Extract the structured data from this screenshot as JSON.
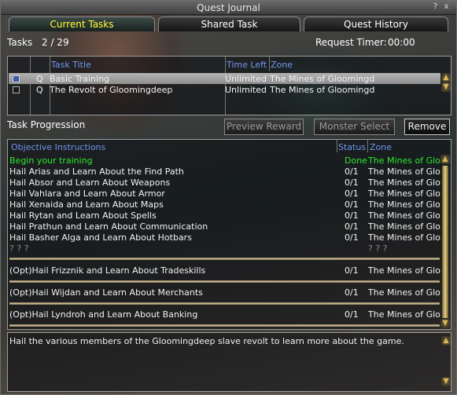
{
  "window": {
    "title": "Quest Journal",
    "help_glyph": "?",
    "close_glyph": "x"
  },
  "tabs": [
    {
      "label": "Current Tasks",
      "active": true
    },
    {
      "label": "Shared Task",
      "active": false
    },
    {
      "label": "Quest History",
      "active": false
    }
  ],
  "summary": {
    "tasks_label": "Tasks",
    "tasks_value": "2 / 29",
    "timer_label": "Request Timer:",
    "timer_value": "00:00"
  },
  "task_list": {
    "columns": [
      "Task Title",
      "Time Left",
      "Zone"
    ],
    "rows": [
      {
        "type": "Q",
        "title": "Basic Training",
        "time_left": "Unlimited",
        "zone": "The Mines of Gloomingd",
        "checked": true,
        "selected": true
      },
      {
        "type": "Q",
        "title": "The Revolt of Gloomingdeep",
        "time_left": "Unlimited",
        "zone": "The Mines of Gloomingd",
        "checked": false,
        "selected": false
      }
    ]
  },
  "progression": {
    "label": "Task Progression",
    "buttons": {
      "preview": "Preview Reward",
      "monster": "Monster Select",
      "remove": "Remove"
    }
  },
  "objectives": {
    "columns": [
      "Objective Instructions",
      "Status",
      "Zone"
    ],
    "rows": [
      {
        "text": "Begin your training",
        "status": "Done",
        "zone": "The Mines of Glo",
        "state": "done"
      },
      {
        "text": "Hail Arias and Learn About the Find Path",
        "status": "0/1",
        "zone": "The Mines of Glo",
        "state": "open"
      },
      {
        "text": "Hail Absor and Learn About Weapons",
        "status": "0/1",
        "zone": "The Mines of Glo",
        "state": "open"
      },
      {
        "text": "Hail Vahlara and Learn About Armor",
        "status": "0/1",
        "zone": "The Mines of Glo",
        "state": "open"
      },
      {
        "text": "Hail Xenaida and Learn About Maps",
        "status": "0/1",
        "zone": "The Mines of Glo",
        "state": "open"
      },
      {
        "text": "Hail Rytan and Learn About Spells",
        "status": "0/1",
        "zone": "The Mines of Glo",
        "state": "open"
      },
      {
        "text": "Hail Prathun and Learn About Communication",
        "status": "0/1",
        "zone": "The Mines of Glo",
        "state": "open"
      },
      {
        "text": "Hail Basher Alga and Learn About Hotbars",
        "status": "0/1",
        "zone": "The Mines of Glo",
        "state": "open"
      },
      {
        "text": "? ? ?",
        "status": "",
        "zone": "? ? ?",
        "state": "unknown"
      }
    ],
    "optional_rows": [
      {
        "text": "(Opt)Hail Frizznik and Learn About Tradeskills",
        "status": "0/1",
        "zone": "The Mines of Glo"
      },
      {
        "text": "(Opt)Hail Wijdan and Learn About Merchants",
        "status": "0/1",
        "zone": "The Mines of Glo"
      },
      {
        "text": "(Opt)Hail Lyndroh and Learn About Banking",
        "status": "0/1",
        "zone": "The Mines of Glo"
      }
    ]
  },
  "description": "Hail the various members of the Gloomingdeep slave revolt to learn more about the game.",
  "colors": {
    "header_blue": "#6f96f0",
    "done_green": "#2ee82e",
    "active_tab_yellow": "#ffff33"
  }
}
